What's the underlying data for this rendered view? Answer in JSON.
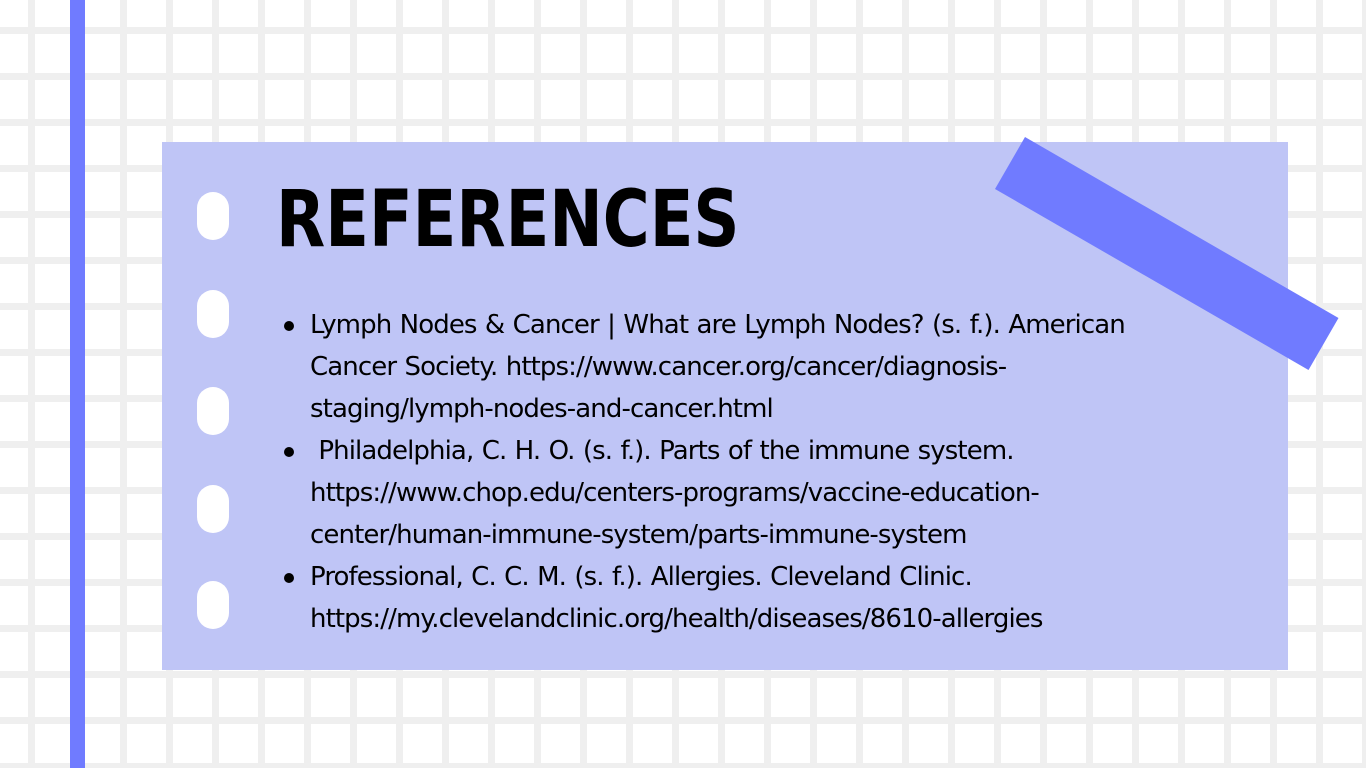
{
  "slide": {
    "title": "REFERENCES",
    "references": [
      {
        "lines": [
          "Lymph Nodes & Cancer | What are Lymph Nodes? (s. f.). American",
          "Cancer Society. https://www.cancer.org/cancer/diagnosis-",
          "staging/lymph-nodes-and-cancer.html"
        ]
      },
      {
        "lines": [
          " Philadelphia, C. H. O. (s. f.). Parts of the immune system.",
          "https://www.chop.edu/centers-programs/vaccine-education-",
          "center/human-immune-system/parts-immune-system"
        ]
      },
      {
        "lines": [
          "Professional, C. C. M. (s. f.). Allergies. Cleveland Clinic.",
          "https://my.clevelandclinic.org/health/diseases/8610-allergies"
        ]
      }
    ]
  },
  "colors": {
    "accent": "#707bff",
    "card_background": "#bfc5f6",
    "grid_line": "#efefef",
    "page_background": "#ffffff",
    "text": "#000000"
  }
}
